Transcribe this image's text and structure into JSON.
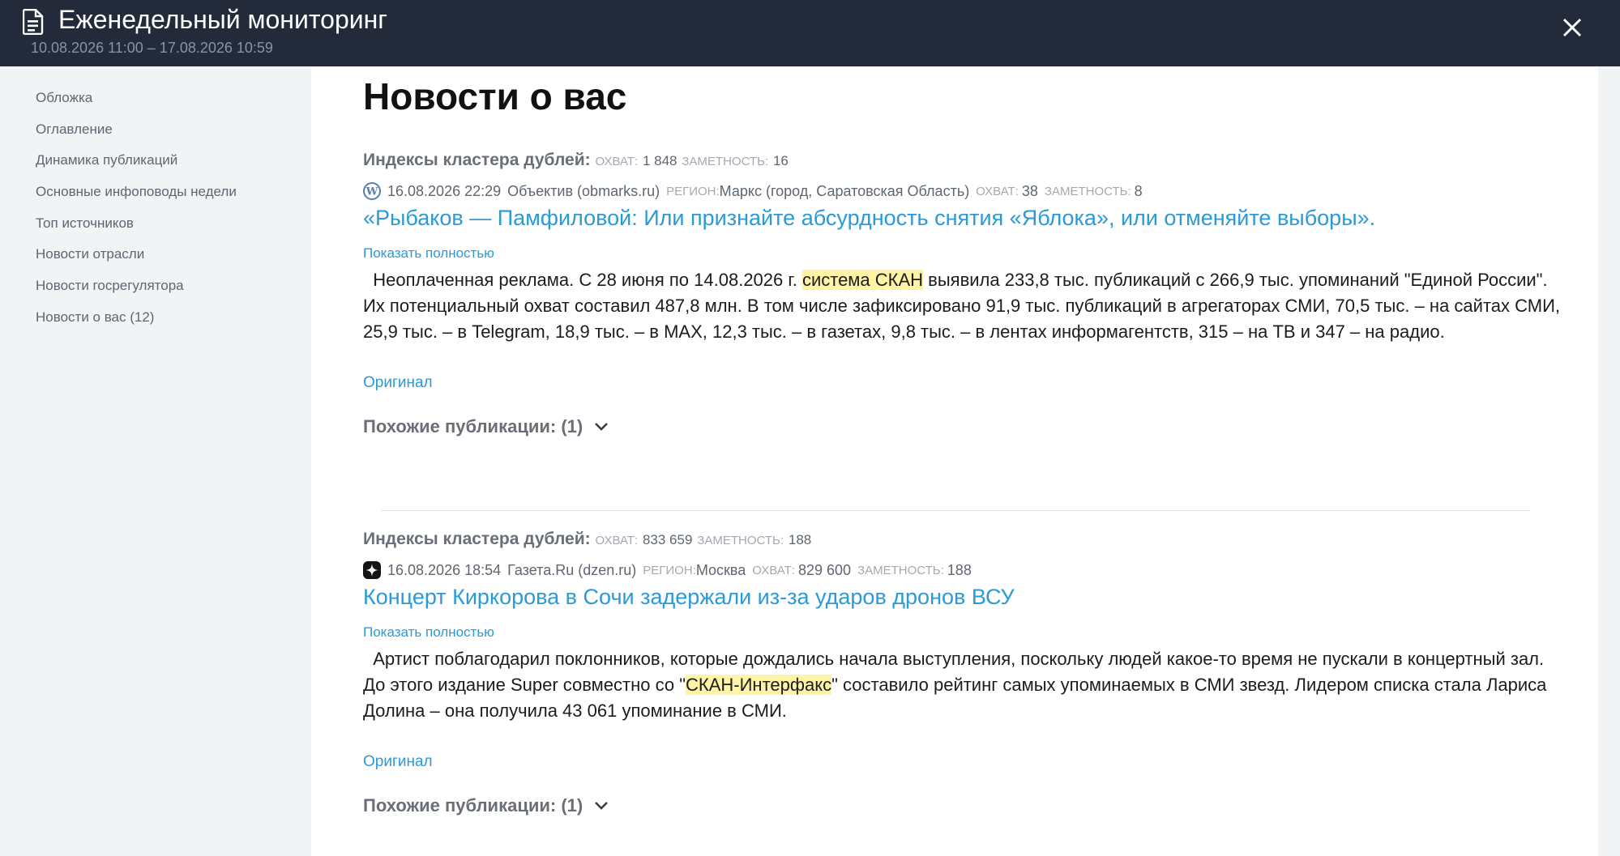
{
  "header": {
    "title": "Еженедельный мониторинг",
    "subtitle": "10.08.2026 11:00 – 17.08.2026 10:59",
    "icon": "document-icon",
    "close_icon": "close-icon"
  },
  "sidebar": {
    "items": [
      {
        "label": "Обложка"
      },
      {
        "label": "Оглавление"
      },
      {
        "label": "Динамика публикаций"
      },
      {
        "label": "Основные инфоповоды недели"
      },
      {
        "label": "Топ источников"
      },
      {
        "label": "Новости отрасли"
      },
      {
        "label": "Новости госрегулятора"
      },
      {
        "label": "Новости о вас (12)"
      }
    ]
  },
  "main": {
    "title": "Новости о вас",
    "items": [
      {
        "cluster_label": "Индексы кластера дублей:",
        "cluster_reach_key": "ОХВАТ:",
        "cluster_reach": "1 848",
        "cluster_visibility_key": "ЗАМЕТНОСТЬ:",
        "cluster_visibility": "16",
        "source_icon": "wordpress-icon",
        "datetime": "16.08.2026 22:29",
        "source": "Объектив (obmarks.ru)",
        "region_key": "РЕГИОН:",
        "region": "Маркс (город, Саратовская Область)",
        "reach_key": "ОХВАТ:",
        "reach": "38",
        "visibility_key": "ЗАМЕТНОСТЬ:",
        "visibility": "8",
        "headline": "«Рыбаков — Памфиловой: Или признайте абсурдность снятия «Яблока», или отменяйте выборы».",
        "show_full": "Показать полностью",
        "snippet_before": "Неоплаченная реклама. С 28 июня по 14.08.2026 г. ",
        "snippet_highlight": "система СКАН",
        "snippet_after": " выявила 233,8 тыс. публикаций с 266,9 тыс. упоминаний \"Единой России\". Их потенциальный охват составил 487,8 млн. В том числе зафиксировано 91,9 тыс. публикаций в агрегаторах СМИ, 70,5 тыс. – на сайтах СМИ, 25,9 тыс. – в Telegram, 18,9 тыс. – в MAX, 12,3 тыс. – в газетах, 9,8 тыс. – в лентах информагентств, 315 – на ТВ и 347 – на радио.",
        "original": "Оригинал",
        "similar": "Похожие публикации: (1)"
      },
      {
        "cluster_label": "Индексы кластера дублей:",
        "cluster_reach_key": "ОХВАТ:",
        "cluster_reach": "833 659",
        "cluster_visibility_key": "ЗАМЕТНОСТЬ:",
        "cluster_visibility": "188",
        "source_icon": "dzen-icon",
        "datetime": "16.08.2026 18:54",
        "source": "Газета.Ru (dzen.ru)",
        "region_key": "РЕГИОН:",
        "region": "Москва",
        "reach_key": "ОХВАТ:",
        "reach": "829 600",
        "visibility_key": "ЗАМЕТНОСТЬ:",
        "visibility": "188",
        "headline": "Концерт Киркорова в Сочи задержали из-за ударов дронов ВСУ",
        "show_full": "Показать полностью",
        "snippet_before": "Артист поблагодарил поклонников, которые дождались начала выступления, поскольку людей какое-то время не пускали в концертный зал. До этого издание Super совместно со \"",
        "snippet_highlight": "СКАН-Интерфакс",
        "snippet_after": "\" составило рейтинг самых упоминаемых в СМИ звезд. Лидером списка стала Лариса Долина – она получила 43 061 упоминание в СМИ.",
        "original": "Оригинал",
        "similar": "Похожие публикации: (1)"
      }
    ]
  },
  "colors": {
    "topbar": "#232b3a",
    "link": "#2a9ad8",
    "highlight": "#fff3a6"
  }
}
